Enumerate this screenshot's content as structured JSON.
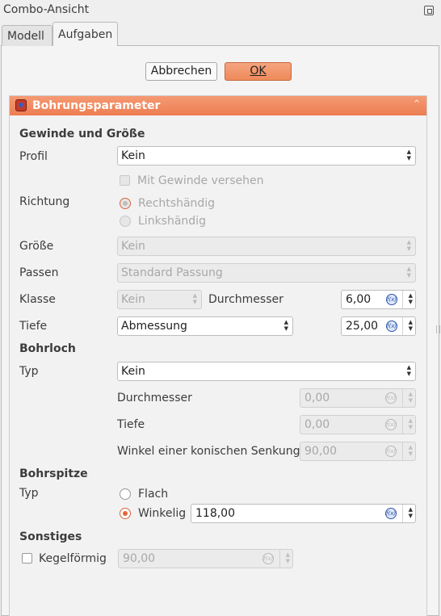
{
  "window": {
    "title": "Combo-Ansicht"
  },
  "tabs": [
    {
      "label": "Modell"
    },
    {
      "label": "Aufgaben"
    }
  ],
  "actions": {
    "cancel": "Abbrechen",
    "ok": "OK"
  },
  "panel": {
    "title": "Bohrungsparameter"
  },
  "thread": {
    "section": "Gewinde und Größe",
    "profile_label": "Profil",
    "profile_value": "Kein",
    "threaded_label": "Mit Gewinde versehen",
    "direction_label": "Richtung",
    "right_hand": "Rechtshändig",
    "left_hand": "Linkshändig",
    "size_label": "Größe",
    "size_value": "Kein",
    "fit_label": "Passen",
    "fit_value": "Standard Passung",
    "class_label": "Klasse",
    "class_value": "Kein",
    "diameter_label": "Durchmesser",
    "diameter_value": "6,00",
    "depth_label": "Tiefe",
    "depth_type_value": "Abmessung",
    "depth_value": "25,00"
  },
  "hole": {
    "section": "Bohrloch",
    "type_label": "Typ",
    "type_value": "Kein",
    "diameter_label": "Durchmesser",
    "diameter_value": "0,00",
    "depth_label": "Tiefe",
    "depth_value": "0,00",
    "angle_label": "Winkel einer konischen Senkung",
    "angle_value": "90,00"
  },
  "drill_point": {
    "section": "Bohrspitze",
    "type_label": "Typ",
    "flat": "Flach",
    "angled": "Winkelig",
    "angle_value": "118,00"
  },
  "misc": {
    "section": "Sonstiges",
    "tapered_label": "Kegelförmig",
    "tapered_value": "90,00"
  },
  "colors": {
    "accent": "#ee8a5a",
    "panel_header": "#f08a5e"
  }
}
